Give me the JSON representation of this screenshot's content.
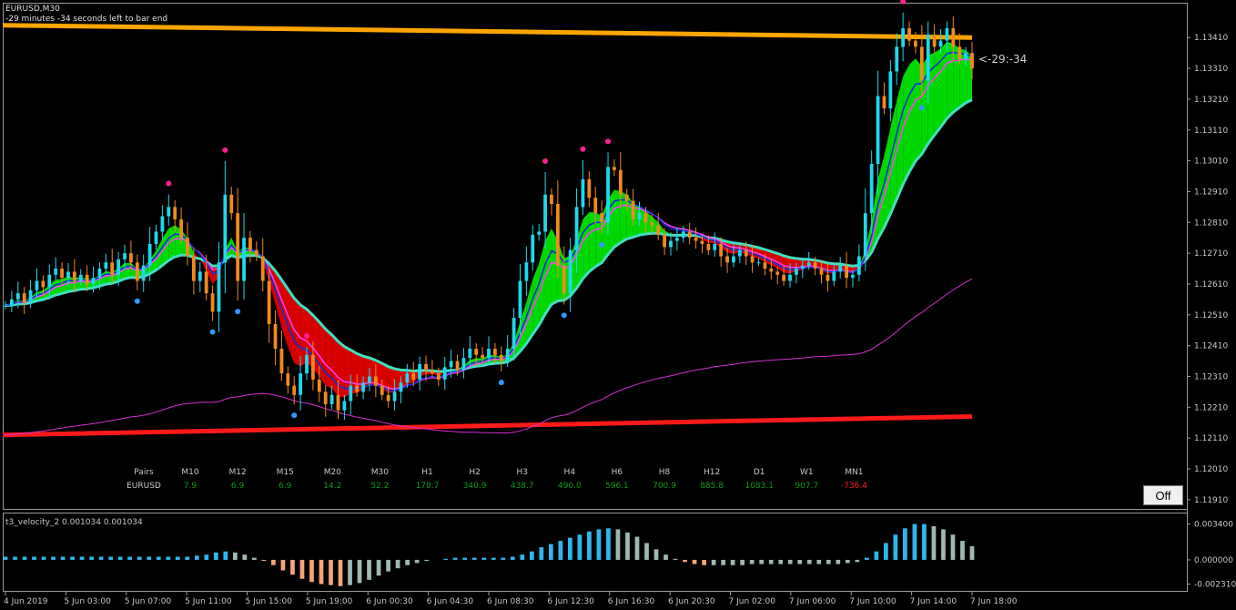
{
  "window": {
    "symbol_title": "EURUSD,M30",
    "timer_text": "-29 minutes -34 seconds left to bar end",
    "countdown": "<-29:-34",
    "off_button_label": "Off"
  },
  "colors": {
    "background": "#000000",
    "bull_candle": "#1fd8ec",
    "bear_candle": "#f08a1e",
    "resistance_line": "#ffa500",
    "support_line": "#ff1a1a",
    "cloud_bull": "#00ff00",
    "cloud_bear": "#ff0000",
    "cloud_edge": "#40e0c0",
    "blue_line": "#1030d0",
    "magenta_line": "#ff40ff",
    "slow_ma": "#d030d0",
    "up_dot": "#3399ff",
    "down_dot": "#ff2090",
    "hist_up": "#2fb6ef",
    "hist_down": "#f4a37a",
    "hist_fade": "#a0b8b0",
    "table_positive": "#0e9a1e",
    "table_negative": "#ff2020"
  },
  "strength_table": {
    "row_label": "EURUSD",
    "header_label": "Pairs",
    "timeframes": [
      "M10",
      "M12",
      "M15",
      "M20",
      "M30",
      "H1",
      "H2",
      "H3",
      "H4",
      "H6",
      "H8",
      "H12",
      "D1",
      "W1",
      "MN1"
    ],
    "values": [
      "7.9",
      "6.9",
      "6.9",
      "14.2",
      "52.2",
      "178.7",
      "340.9",
      "438.7",
      "490.0",
      "596.1",
      "700.9",
      "885.8",
      "1083.1",
      "907.7",
      "-736.4"
    ]
  },
  "indicator": {
    "title": "t3_velocity_2 0.001034 0.001034",
    "axis_ticks": [
      "0.003400",
      "0.000000",
      "-0.002310"
    ]
  },
  "chart_data": {
    "type": "candlestick",
    "symbol": "EURUSD",
    "timeframe": "M30",
    "price_ticks": [
      "1.13410",
      "1.13310",
      "1.13210",
      "1.13110",
      "1.13010",
      "1.12910",
      "1.12810",
      "1.12710",
      "1.12610",
      "1.12510",
      "1.12410",
      "1.12310",
      "1.12210",
      "1.12110",
      "1.12010",
      "1.11910"
    ],
    "x_ticks": [
      "4 Jun 2019",
      "5 Jun 03:00",
      "5 Jun 07:00",
      "5 Jun 11:00",
      "5 Jun 15:00",
      "5 Jun 19:00",
      "6 Jun 00:30",
      "6 Jun 04:30",
      "6 Jun 08:30",
      "6 Jun 12:30",
      "6 Jun 16:30",
      "6 Jun 20:30",
      "7 Jun 02:00",
      "7 Jun 06:00",
      "7 Jun 10:00",
      "7 Jun 14:00",
      "7 Jun 18:00"
    ],
    "ylim": [
      1.1188,
      1.1352
    ],
    "resistance": {
      "start": 1.1345,
      "end": 1.1341
    },
    "support": {
      "start": 1.1212,
      "end": 1.1218
    },
    "close": [
      1.1254,
      1.1256,
      1.1258,
      1.1255,
      1.1259,
      1.1262,
      1.126,
      1.1264,
      1.1266,
      1.1263,
      1.1265,
      1.1262,
      1.1264,
      1.1261,
      1.1263,
      1.1266,
      1.1268,
      1.1264,
      1.1269,
      1.1271,
      1.1268,
      1.1262,
      1.1267,
      1.1274,
      1.1278,
      1.1283,
      1.1286,
      1.1282,
      1.1276,
      1.127,
      1.1262,
      1.1265,
      1.1258,
      1.1252,
      1.1268,
      1.129,
      1.1284,
      1.1262,
      1.1276,
      1.1272,
      1.127,
      1.1262,
      1.1248,
      1.124,
      1.1232,
      1.1228,
      1.1225,
      1.1232,
      1.1238,
      1.123,
      1.1226,
      1.1222,
      1.1225,
      1.122,
      1.1223,
      1.1228,
      1.1226,
      1.1229,
      1.1231,
      1.1228,
      1.1225,
      1.1223,
      1.1226,
      1.1229,
      1.1232,
      1.123,
      1.1235,
      1.1233,
      1.1232,
      1.123,
      1.1234,
      1.1236,
      1.1233,
      1.1237,
      1.124,
      1.1238,
      1.1237,
      1.124,
      1.1238,
      1.1236,
      1.124,
      1.125,
      1.1262,
      1.1268,
      1.1277,
      1.1278,
      1.129,
      1.1287,
      1.1267,
      1.1258,
      1.1272,
      1.1286,
      1.1295,
      1.1289,
      1.1284,
      1.1281,
      1.1299,
      1.1298,
      1.129,
      1.1288,
      1.1282,
      1.1284,
      1.1281,
      1.128,
      1.1277,
      1.1273,
      1.1275,
      1.1276,
      1.1278,
      1.1276,
      1.1275,
      1.1274,
      1.1272,
      1.1274,
      1.127,
      1.1268,
      1.127,
      1.1272,
      1.127,
      1.1268,
      1.1268,
      1.1266,
      1.1265,
      1.1264,
      1.1262,
      1.1264,
      1.1266,
      1.1267,
      1.1268,
      1.1266,
      1.1264,
      1.1262,
      1.1265,
      1.1267,
      1.1263,
      1.1264,
      1.127,
      1.1284,
      1.13,
      1.1322,
      1.1318,
      1.133,
      1.1338,
      1.1344,
      1.134,
      1.1338,
      1.1327,
      1.1342,
      1.1338,
      1.134,
      1.1344,
      1.1338,
      1.1334,
      1.1336,
      1.1331
    ],
    "indicator_values": [
      0.0003,
      0.0003,
      0.0003,
      0.0003,
      0.0003,
      0.0003,
      0.0003,
      0.0003,
      0.0003,
      0.0003,
      0.0003,
      0.0003,
      0.0003,
      0.0003,
      0.0003,
      0.0003,
      0.0003,
      0.0003,
      0.0003,
      0.0003,
      0.0004,
      0.0005,
      0.0007,
      0.0008,
      0.0007,
      0.0005,
      0.0002,
      -0.0001,
      -0.0005,
      -0.001,
      -0.0014,
      -0.0018,
      -0.0021,
      -0.0023,
      -0.0024,
      -0.0025,
      -0.0024,
      -0.0022,
      -0.0019,
      -0.0015,
      -0.0011,
      -0.0008,
      -0.0005,
      -0.0003,
      -0.0001,
      0.0,
      0.0001,
      0.0002,
      0.0002,
      0.0002,
      0.0002,
      0.0002,
      0.0002,
      0.0003,
      0.0005,
      0.0008,
      0.0012,
      0.0015,
      0.0018,
      0.0021,
      0.0024,
      0.0027,
      0.0029,
      0.003,
      0.0029,
      0.0026,
      0.0022,
      0.0016,
      0.001,
      0.0005,
      0.0001,
      -0.0002,
      -0.0004,
      -0.0005,
      -0.0005,
      -0.0005,
      -0.0005,
      -0.0005,
      -0.0004,
      -0.0004,
      -0.0004,
      -0.0004,
      -0.0004,
      -0.0004,
      -0.0004,
      -0.0004,
      -0.0004,
      -0.0004,
      -0.0003,
      -0.0002,
      0.0002,
      0.0008,
      0.0016,
      0.0024,
      0.003,
      0.0034,
      0.0034,
      0.0032,
      0.0029,
      0.0024,
      0.0018,
      0.0013
    ]
  }
}
